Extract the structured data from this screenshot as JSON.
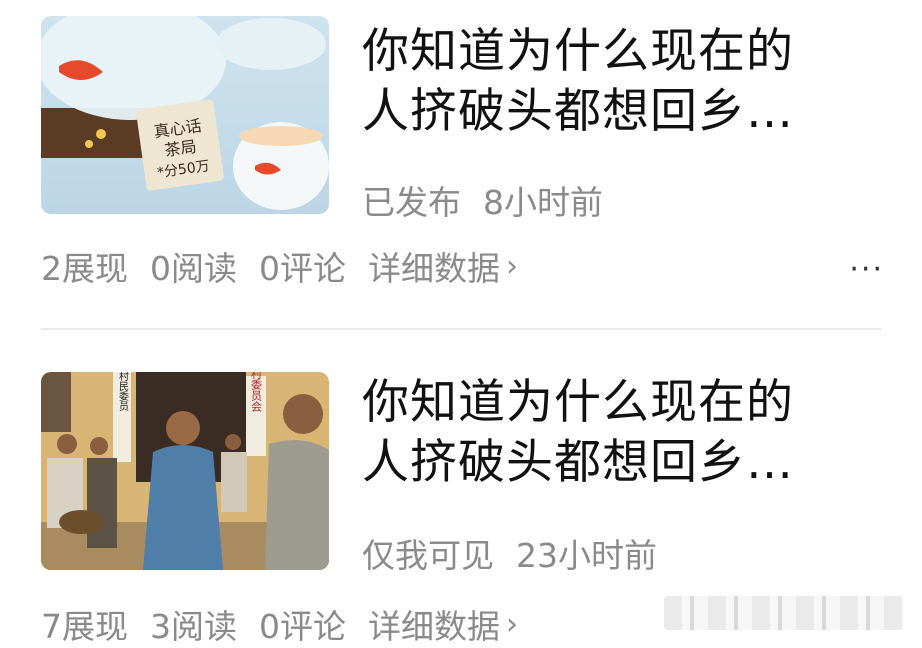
{
  "items": [
    {
      "title": "你知道为什么现在的人挤破头都想回乡…",
      "title_line1": "你知道为什么现在的",
      "title_line2": "人挤破头都想回乡…",
      "status": "已发布",
      "time": "8小时前",
      "thumb_sign_line1": "真心话",
      "thumb_sign_line2": "茶局",
      "thumb_sign_line3": "*分50万",
      "stats": {
        "impressions": "2展现",
        "reads": "0阅读",
        "comments": "0评论",
        "detail": "详细数据"
      }
    },
    {
      "title": "你知道为什么现在的人挤破头都想回乡…",
      "title_line1": "你知道为什么现在的",
      "title_line2": "人挤破头都想回乡…",
      "status": "仅我可见",
      "time": "23小时前",
      "thumb_sign_left": "村村民委员",
      "thumb_sign_right": "村委员会",
      "stats": {
        "impressions": "7展现",
        "reads": "3阅读",
        "comments": "0评论",
        "detail": "详细数据"
      }
    }
  ],
  "more_label": "···",
  "icons": {
    "detail_chevron": "chevron-right-icon",
    "more": "more-dots-icon"
  }
}
